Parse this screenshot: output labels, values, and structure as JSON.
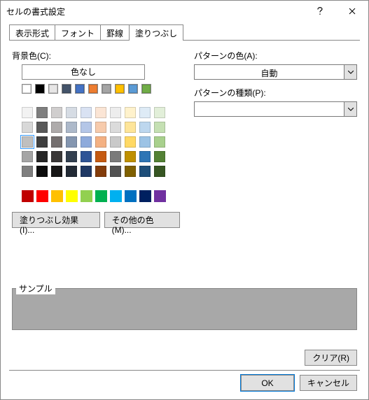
{
  "window_title": "セルの書式設定",
  "tabs": [
    "表示形式",
    "フォント",
    "罫線",
    "塗りつぶし"
  ],
  "active_tab": 3,
  "labels": {
    "bg_color": "背景色(C):",
    "no_color": "色なし",
    "pattern_color": "パターンの色(A):",
    "pattern_type": "パターンの種類(P):",
    "fill_effects": "塗りつぶし効果(I)...",
    "other_colors": "その他の色(M)...",
    "sample": "サンプル",
    "clear": "クリア(R)",
    "ok": "OK",
    "cancel": "キャンセル"
  },
  "pattern_color_value": "自動",
  "pattern_type_value": "",
  "theme_colors": [
    [
      "#ffffff",
      "#000000",
      "#e7e6e6",
      "#44546a",
      "#4472c4",
      "#ed7d31",
      "#a5a5a5",
      "#ffc000",
      "#5b9bd5",
      "#70ad47"
    ],
    [
      "#f2f2f2",
      "#7f7f7f",
      "#d0cece",
      "#d6dce4",
      "#d9e2f3",
      "#fbe5d5",
      "#ededed",
      "#fff2cc",
      "#deebf6",
      "#e2efd9"
    ],
    [
      "#d8d8d8",
      "#595959",
      "#aeabab",
      "#adb9ca",
      "#b4c6e7",
      "#f7cbac",
      "#dbdbdb",
      "#fee599",
      "#bdd7ee",
      "#c5e0b3"
    ],
    [
      "#bfbfbf",
      "#3f3f3f",
      "#757070",
      "#8496b0",
      "#8eaadb",
      "#f4b183",
      "#c9c9c9",
      "#ffd965",
      "#9cc3e5",
      "#a8d08d"
    ],
    [
      "#a5a5a5",
      "#262626",
      "#3a3838",
      "#323f4f",
      "#2f5496",
      "#c55a11",
      "#7b7b7b",
      "#bf9000",
      "#2e75b5",
      "#538135"
    ],
    [
      "#7f7f7f",
      "#0c0c0c",
      "#171616",
      "#222a35",
      "#1f3864",
      "#833c0b",
      "#525252",
      "#7f6000",
      "#1e4e79",
      "#375623"
    ]
  ],
  "standard_colors": [
    "#c00000",
    "#ff0000",
    "#ffc000",
    "#ffff00",
    "#92d050",
    "#00b050",
    "#00b0f0",
    "#0070c0",
    "#002060",
    "#7030a0"
  ],
  "selected_swatch": {
    "group": "theme",
    "row": 3,
    "col": 0
  },
  "sample_fill": "#a8a8a8"
}
